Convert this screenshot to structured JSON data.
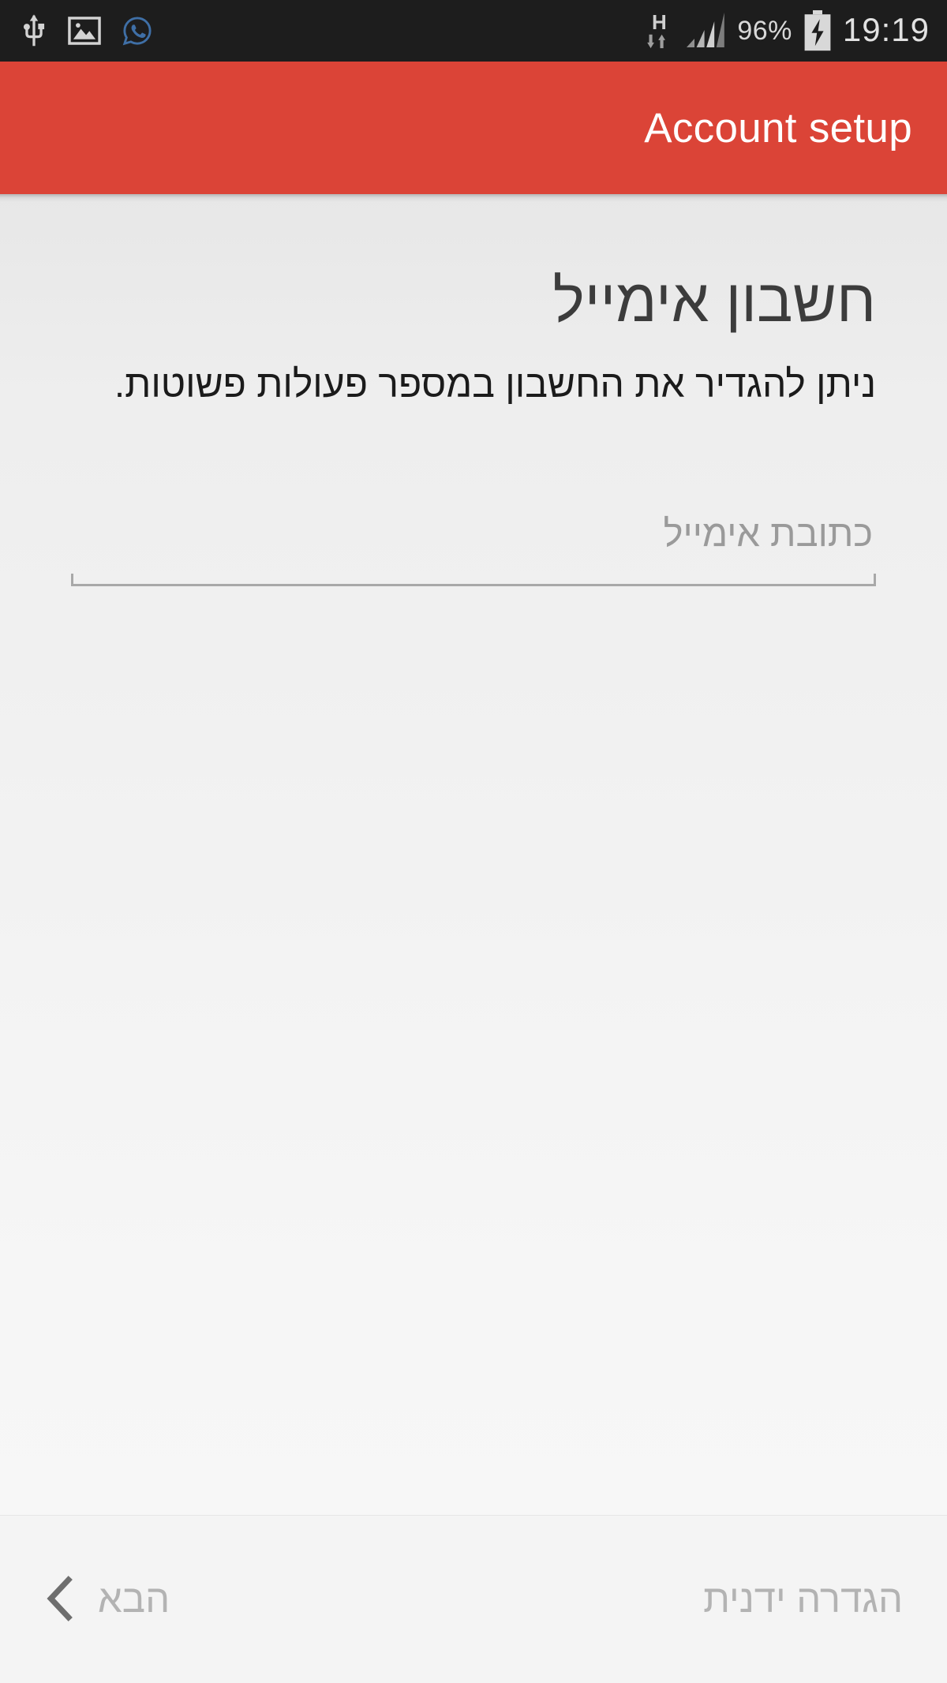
{
  "status_bar": {
    "left_icons": [
      {
        "name": "usb-icon",
        "label": "USB connected"
      },
      {
        "name": "screenshot-image-icon",
        "label": "Screenshot captured"
      },
      {
        "name": "whatsapp-icon",
        "label": "WhatsApp notification"
      }
    ],
    "network_type": "H",
    "data_activity": "down-up-arrows",
    "signal_bars_total": 4,
    "signal_bars_filled": 3,
    "battery_percent": "96%",
    "battery_state": "charging",
    "clock": "19:19"
  },
  "app_bar": {
    "title": "Account setup",
    "background_color": "#db4437",
    "title_color": "#ffffff"
  },
  "content": {
    "headline": "חשבון אימייל",
    "subtext": "ניתן להגדיר את החשבון במספר פעולות פשוטות.",
    "email_field": {
      "value": "",
      "placeholder": "כתובת אימייל"
    }
  },
  "bottom_bar": {
    "next_label": "הבא",
    "next_icon": "chevron-left-icon",
    "manual_label": "הגדרה ידנית",
    "disabled_text_color": "#b3b3b3"
  }
}
